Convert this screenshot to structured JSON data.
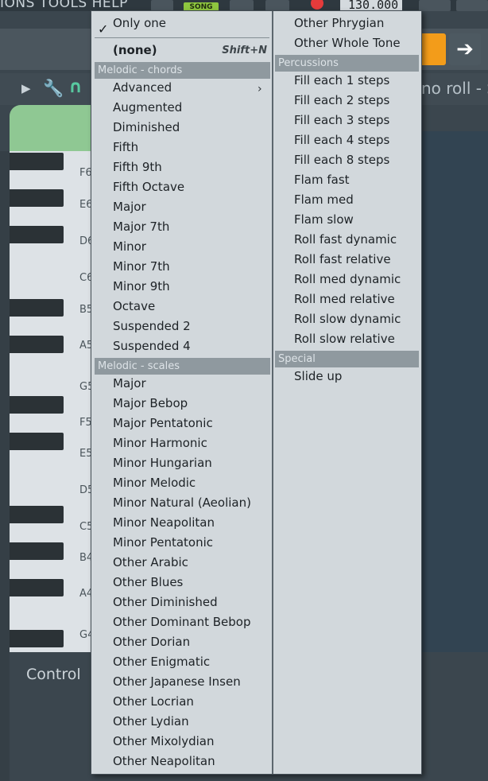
{
  "app": {
    "menu_fragment": "IONS TOOLS HELP",
    "song_mode": "SONG",
    "tempo": "130.000",
    "piano_roll_title": "no roll - S",
    "control_label": "Control"
  },
  "piano_keys": [
    "F6",
    "E6",
    "D6",
    "C6",
    "B5",
    "A5",
    "G5",
    "F5",
    "E5",
    "D5",
    "C5",
    "B4",
    "A4",
    "G4"
  ],
  "menu": {
    "only_one": "Only one",
    "none_label": "(none)",
    "none_shortcut": "Shift+N",
    "sections": {
      "chords": "Melodic - chords",
      "scales": "Melodic - scales",
      "percussions": "Percussions",
      "special": "Special"
    },
    "chords": [
      "Advanced",
      "Augmented",
      "Diminished",
      "Fifth",
      "Fifth 9th",
      "Fifth Octave",
      "Major",
      "Major 7th",
      "Minor",
      "Minor 7th",
      "Minor 9th",
      "Octave",
      "Suspended 2",
      "Suspended 4"
    ],
    "scales": [
      "Major",
      "Major Bebop",
      "Major Pentatonic",
      "Minor Harmonic",
      "Minor Hungarian",
      "Minor Melodic",
      "Minor Natural (Aeolian)",
      "Minor Neapolitan",
      "Minor Pentatonic",
      "Other Arabic",
      "Other Blues",
      "Other Diminished",
      "Other Dominant Bebop",
      "Other Dorian",
      "Other Enigmatic",
      "Other Japanese Insen",
      "Other Locrian",
      "Other Lydian",
      "Other Mixolydian",
      "Other Neapolitan"
    ],
    "scales_cont": [
      "Other Phrygian",
      "Other Whole Tone"
    ],
    "percussions": [
      "Fill each 1 steps",
      "Fill each 2 steps",
      "Fill each 3 steps",
      "Fill each 4 steps",
      "Fill each 8 steps",
      "Flam fast",
      "Flam med",
      "Flam slow",
      "Roll fast dynamic",
      "Roll fast relative",
      "Roll med dynamic",
      "Roll med relative",
      "Roll slow dynamic",
      "Roll slow relative"
    ],
    "special": [
      "Slide up"
    ]
  },
  "colors": {
    "menu_bg": "#d2d8dc",
    "section_bg": "#8f999f",
    "song_green": "#8ec63f",
    "record_red": "#e43b3b",
    "accent_orange": "#f39c1a"
  }
}
